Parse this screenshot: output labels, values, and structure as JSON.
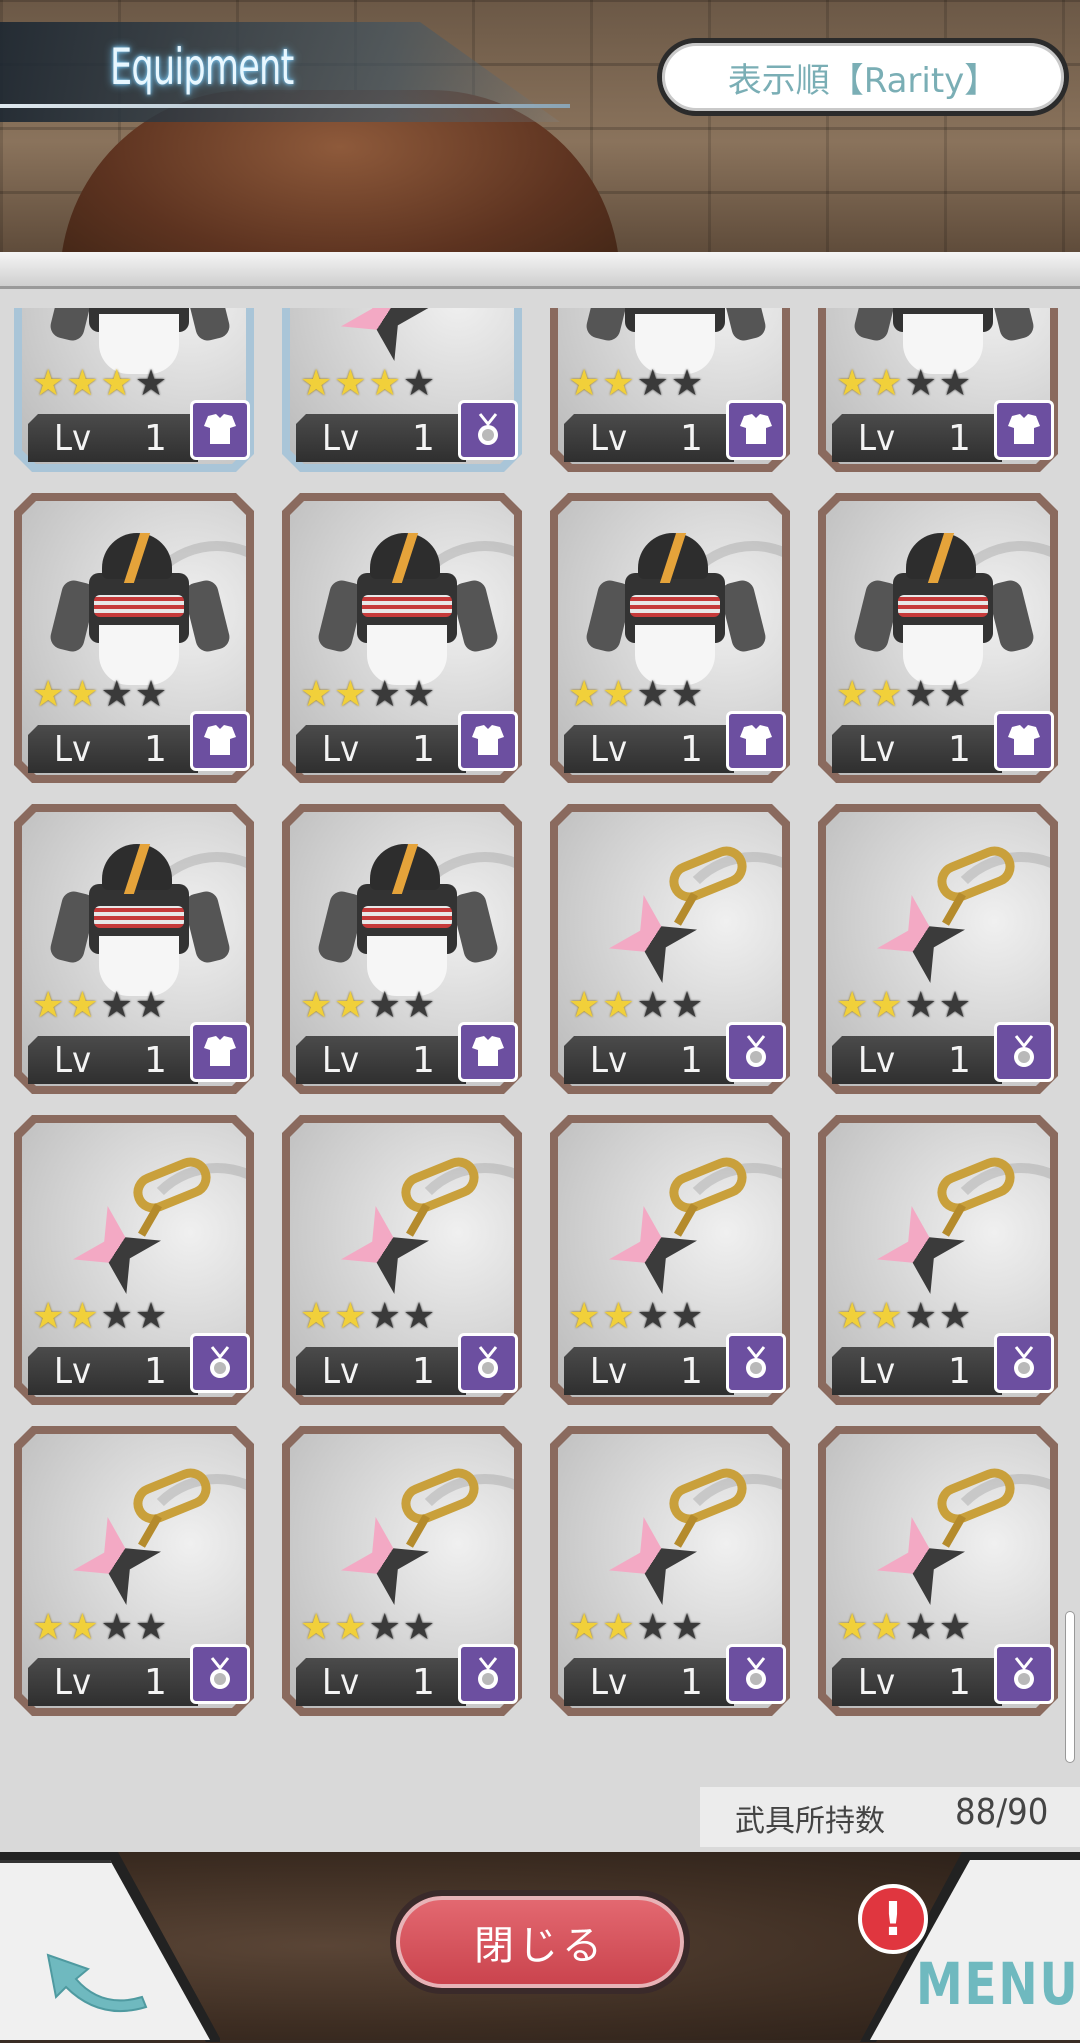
{
  "header": {
    "title": "Equipment",
    "sort_label": "表示順【Rarity】"
  },
  "items": [
    {
      "kind": "armor",
      "stars": 3,
      "level": "1",
      "slot": "armor-slot-icon",
      "highlight": true
    },
    {
      "kind": "shuriken",
      "stars": 3,
      "level": "1",
      "slot": "accessory-slot-icon",
      "highlight": true
    },
    {
      "kind": "armor",
      "stars": 2,
      "level": "1",
      "slot": "armor-slot-icon",
      "highlight": false
    },
    {
      "kind": "armor",
      "stars": 2,
      "level": "1",
      "slot": "armor-slot-icon",
      "highlight": false
    },
    {
      "kind": "armor",
      "stars": 2,
      "level": "1",
      "slot": "armor-slot-icon",
      "highlight": false
    },
    {
      "kind": "armor",
      "stars": 2,
      "level": "1",
      "slot": "armor-slot-icon",
      "highlight": false
    },
    {
      "kind": "armor",
      "stars": 2,
      "level": "1",
      "slot": "armor-slot-icon",
      "highlight": false
    },
    {
      "kind": "armor",
      "stars": 2,
      "level": "1",
      "slot": "armor-slot-icon",
      "highlight": false
    },
    {
      "kind": "armor",
      "stars": 2,
      "level": "1",
      "slot": "armor-slot-icon",
      "highlight": false
    },
    {
      "kind": "armor",
      "stars": 2,
      "level": "1",
      "slot": "armor-slot-icon",
      "highlight": false
    },
    {
      "kind": "shuriken",
      "stars": 2,
      "level": "1",
      "slot": "accessory-slot-icon",
      "highlight": false
    },
    {
      "kind": "shuriken",
      "stars": 2,
      "level": "1",
      "slot": "accessory-slot-icon",
      "highlight": false
    },
    {
      "kind": "shuriken",
      "stars": 2,
      "level": "1",
      "slot": "accessory-slot-icon",
      "highlight": false
    },
    {
      "kind": "shuriken",
      "stars": 2,
      "level": "1",
      "slot": "accessory-slot-icon",
      "highlight": false
    },
    {
      "kind": "shuriken",
      "stars": 2,
      "level": "1",
      "slot": "accessory-slot-icon",
      "highlight": false
    },
    {
      "kind": "shuriken",
      "stars": 2,
      "level": "1",
      "slot": "accessory-slot-icon",
      "highlight": false
    },
    {
      "kind": "shuriken",
      "stars": 2,
      "level": "1",
      "slot": "accessory-slot-icon",
      "highlight": false
    },
    {
      "kind": "shuriken",
      "stars": 2,
      "level": "1",
      "slot": "accessory-slot-icon",
      "highlight": false
    },
    {
      "kind": "shuriken",
      "stars": 2,
      "level": "1",
      "slot": "accessory-slot-icon",
      "highlight": false
    },
    {
      "kind": "shuriken",
      "stars": 2,
      "level": "1",
      "slot": "accessory-slot-icon",
      "highlight": false
    }
  ],
  "card": {
    "lv_label": "Lv",
    "max_stars": 4
  },
  "footer": {
    "count_label": "武具所持数",
    "count_value": "88/90",
    "close_label": "閉じる",
    "menu_label": "MENU",
    "alert_mark": "!"
  },
  "colors": {
    "accent": "#6c4fa0",
    "star_on": "#f1d03a",
    "close_button": "#d8535c",
    "menu_text": "#6fb9bf"
  }
}
